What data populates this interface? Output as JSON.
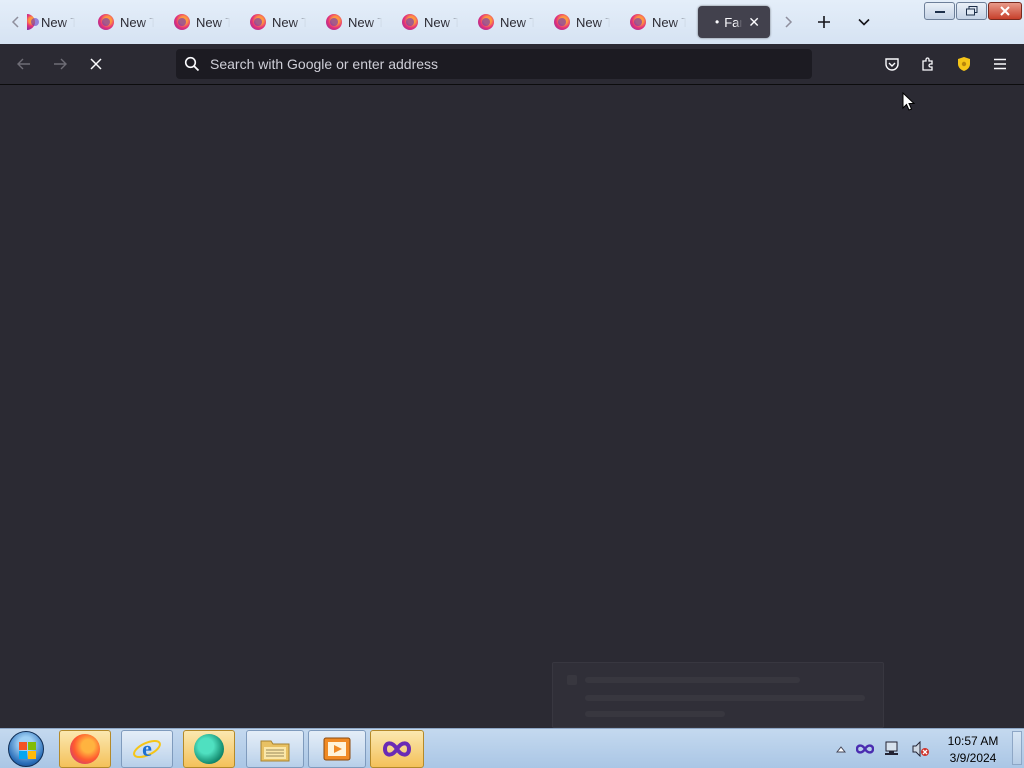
{
  "tabs": {
    "items": [
      {
        "title": "New Tab",
        "icon": "firefox-icon"
      },
      {
        "title": "New Tab",
        "icon": "firefox-icon"
      },
      {
        "title": "New Tab",
        "icon": "firefox-icon"
      },
      {
        "title": "New Tab",
        "icon": "firefox-icon"
      },
      {
        "title": "New Tab",
        "icon": "firefox-icon"
      },
      {
        "title": "New Tab",
        "icon": "firefox-icon"
      },
      {
        "title": "New Tab",
        "icon": "firefox-icon"
      },
      {
        "title": "New Tab",
        "icon": "firefox-icon"
      },
      {
        "title": "New Tab",
        "icon": "firefox-icon"
      }
    ],
    "active": {
      "title": "Fan",
      "indicator": "•",
      "close": "✕"
    },
    "new_tab": "+",
    "list_all": "chevron-down-icon"
  },
  "navbar": {
    "url_placeholder": "Search with Google or enter address",
    "url_value": ""
  },
  "taskbar": {
    "clock_time": "10:57 AM",
    "clock_date": "3/9/2024",
    "apps": [
      "firefox",
      "internet-explorer",
      "app-teal",
      "file-explorer",
      "media-player",
      "visual-studio"
    ]
  },
  "colors": {
    "chrome_bg": "#2b2a33",
    "urlbar_bg": "#1c1b22",
    "tabstrip_bg": "#dce8f6",
    "taskbar_bg": "#b6cfea"
  }
}
